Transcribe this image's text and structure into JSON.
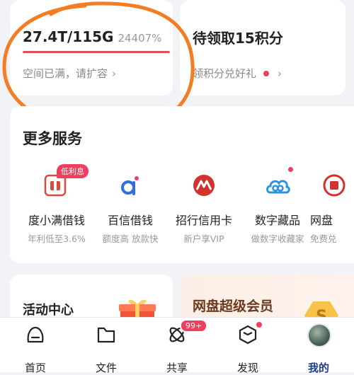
{
  "storage": {
    "usage": "27.4T/115G",
    "percent_text": "24407%",
    "fill_fraction": 1.0,
    "subtitle": "空间已满，请扩容",
    "chevron": "›"
  },
  "points": {
    "title": "待领取15积分",
    "subtitle": "领积分兑好礼",
    "chevron": "›"
  },
  "services": {
    "title": "更多服务",
    "items": [
      {
        "name": "度小满借钱",
        "desc": "年利低至3.6%",
        "tag": "低利息",
        "icon": "loan-icon"
      },
      {
        "name": "百信借钱",
        "desc": "额度高 放款快",
        "icon": "baixin-icon"
      },
      {
        "name": "招行信用卡",
        "desc": "新户享VIP",
        "icon": "cmb-icon"
      },
      {
        "name": "数字藏品",
        "desc": "做数字收藏家",
        "icon": "cloud-icon"
      },
      {
        "name": "网盘",
        "desc": "免费兑",
        "icon": "pan-icon"
      }
    ]
  },
  "activity": {
    "title": "活动中心"
  },
  "vip": {
    "title": "网盘超级会员"
  },
  "tabbar": {
    "items": [
      {
        "label": "首页",
        "icon": "home-icon"
      },
      {
        "label": "文件",
        "icon": "folder-icon"
      },
      {
        "label": "共享",
        "icon": "share-icon",
        "badge": "99+"
      },
      {
        "label": "发现",
        "icon": "discover-icon"
      },
      {
        "label": "我的",
        "icon": "avatar"
      }
    ]
  },
  "colors": {
    "accent": "#ee3f5f",
    "annotation": "#f57c21",
    "active_tab": "#1e3a8a"
  }
}
